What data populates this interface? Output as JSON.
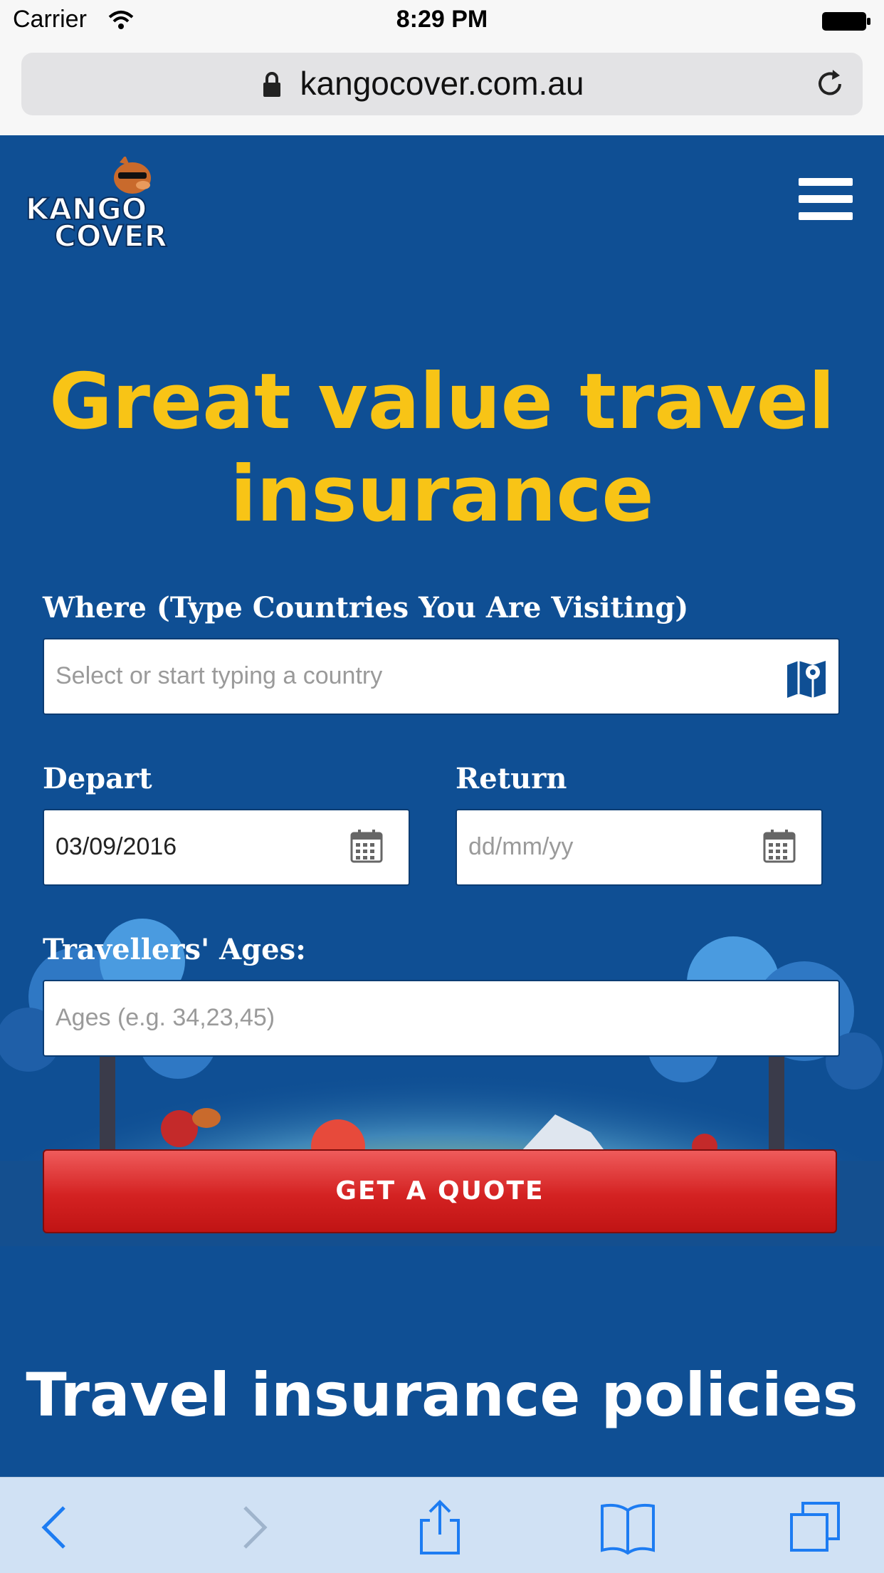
{
  "status_bar": {
    "carrier": "Carrier",
    "time": "8:29 PM"
  },
  "browser": {
    "url": "kangocover.com.au"
  },
  "header": {
    "logo_line1": "KANGO",
    "logo_line2": "COVER"
  },
  "hero": {
    "headline_line1": "Great value travel",
    "headline_line2": "insurance"
  },
  "form": {
    "where_label": "Where (Type Countries You Are Visiting)",
    "where_placeholder": "Select or start typing a country",
    "depart_label": "Depart",
    "depart_value": "03/09/2016",
    "return_label": "Return",
    "return_placeholder": "dd/mm/yy",
    "ages_label": "Travellers' Ages:",
    "ages_placeholder": "Ages (e.g. 34,23,45)",
    "submit_label": "GET A QUOTE"
  },
  "section": {
    "title": "Travel insurance policies"
  },
  "colors": {
    "brand_blue": "#0f4f94",
    "headline_yellow": "#f8c416",
    "button_red": "#d42222"
  }
}
